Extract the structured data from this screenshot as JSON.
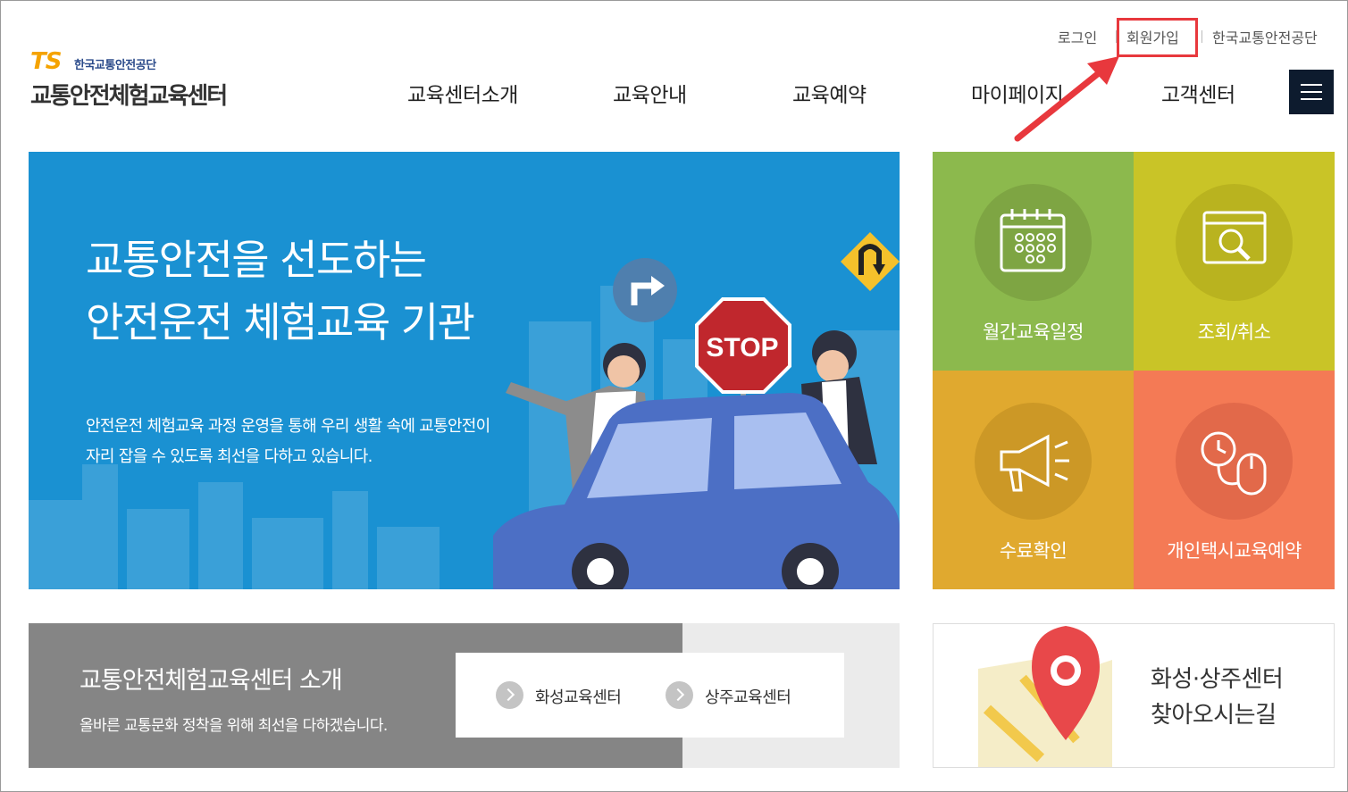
{
  "util": {
    "login": "로그인",
    "join": "회원가입",
    "org": "한국교통안전공단"
  },
  "logo": {
    "ts": "TS",
    "sub": "한국교통안전공단",
    "main": "교통안전체험교육센터"
  },
  "nav": [
    "교육센터소개",
    "교육안내",
    "교육예약",
    "마이페이지",
    "고객센터"
  ],
  "hero": {
    "title_line1": "교통안전을 선도하는",
    "title_line2": "안전운전 체험교육 기관",
    "desc_line1": "안전운전 체험교육 과정 운영을 통해 우리 생활 속에 교통안전이",
    "desc_line2": "자리 잡을 수 있도록 최선을 다하고 있습니다.",
    "stop_sign": "STOP"
  },
  "tiles": [
    {
      "label": "월간교육일정",
      "icon": "calendar-icon",
      "color": "#8cb94d",
      "circle": "#7ea543"
    },
    {
      "label": "조회/취소",
      "icon": "search-window-icon",
      "color": "#c9c427",
      "circle": "#b9b31f"
    },
    {
      "label": "수료확인",
      "icon": "megaphone-icon",
      "color": "#e0a92f",
      "circle": "#cc9826"
    },
    {
      "label": "개인택시교육예약",
      "icon": "clock-mouse-icon",
      "color": "#f47a55",
      "circle": "#e2694a"
    }
  ],
  "intro": {
    "title": "교통안전체험교육센터 소개",
    "desc": "올바른 교통문화 정착을 위해 최선을 다하겠습니다.",
    "link1": "화성교육센터",
    "link2": "상주교육센터"
  },
  "map": {
    "line1": "화성·상주센터",
    "line2": "찾아오시는길"
  },
  "colors": {
    "hero_bg": "#1a91d2",
    "accent_red": "#e8383d",
    "menu_btn": "#0d1b2e"
  }
}
